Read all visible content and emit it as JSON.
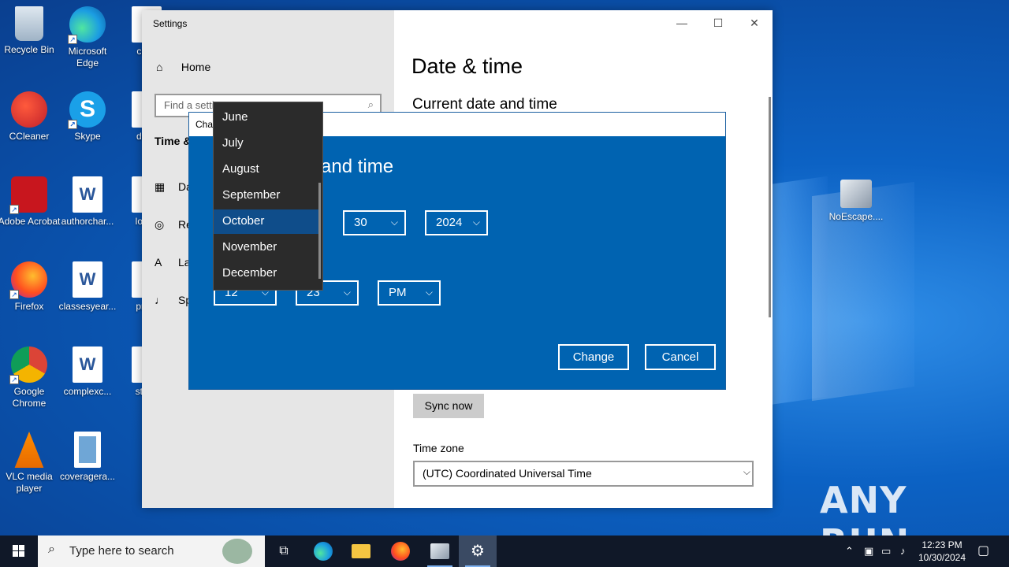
{
  "desktop": {
    "icons": [
      {
        "label": "Recycle Bin",
        "icon": "recycle-bin-icon"
      },
      {
        "label": "Microsoft Edge",
        "icon": "edge-icon"
      },
      {
        "label": "cultu",
        "icon": "word-doc-icon"
      },
      {
        "label": "CCleaner",
        "icon": "ccleaner-icon"
      },
      {
        "label": "Skype",
        "icon": "skype-icon"
      },
      {
        "label": "detai",
        "icon": "word-doc-icon"
      },
      {
        "label": "Adobe Acrobat",
        "icon": "acrobat-icon"
      },
      {
        "label": "authorchar...",
        "icon": "word-doc-icon"
      },
      {
        "label": "loans",
        "icon": "word-doc-icon"
      },
      {
        "label": "Firefox",
        "icon": "firefox-icon"
      },
      {
        "label": "classesyear...",
        "icon": "word-doc-icon"
      },
      {
        "label": "proto",
        "icon": "word-doc-icon"
      },
      {
        "label": "Google Chrome",
        "icon": "chrome-icon"
      },
      {
        "label": "complexc...",
        "icon": "word-doc-icon"
      },
      {
        "label": "stanc",
        "icon": "word-doc-icon"
      },
      {
        "label": "VLC media player",
        "icon": "vlc-icon"
      },
      {
        "label": "coveragera...",
        "icon": "image-file-icon"
      },
      {
        "label": "NoEscape....",
        "icon": "noescape-icon"
      }
    ],
    "watermark": "ANY RUN"
  },
  "settings": {
    "window_title": "Settings",
    "home_label": "Home",
    "search_placeholder": "Find a setti",
    "section_label": "Time &",
    "nav_items": [
      {
        "label": "Da",
        "icon": "calendar-icon"
      },
      {
        "label": "Re",
        "icon": "globe-icon"
      },
      {
        "label": "La",
        "icon": "language-icon"
      },
      {
        "label": "Sp",
        "icon": "microphone-icon"
      }
    ],
    "page_title": "Date & time",
    "subheading": "Current date and time",
    "sync_button": "Sync now",
    "timezone_label": "Time zone",
    "timezone_value": "(UTC) Coordinated Universal Time"
  },
  "dialog": {
    "title": "Cha",
    "heading": "and time",
    "day_value": "30",
    "year_value": "2024",
    "hour_value": "12",
    "minute_value": "23",
    "ampm_value": "PM",
    "change_button": "Change",
    "cancel_button": "Cancel"
  },
  "month_dropdown": {
    "items": [
      "June",
      "July",
      "August",
      "September",
      "October",
      "November",
      "December"
    ],
    "selected": "October"
  },
  "taskbar": {
    "search_placeholder": "Type here to search",
    "time": "12:23 PM",
    "date": "10/30/2024"
  }
}
